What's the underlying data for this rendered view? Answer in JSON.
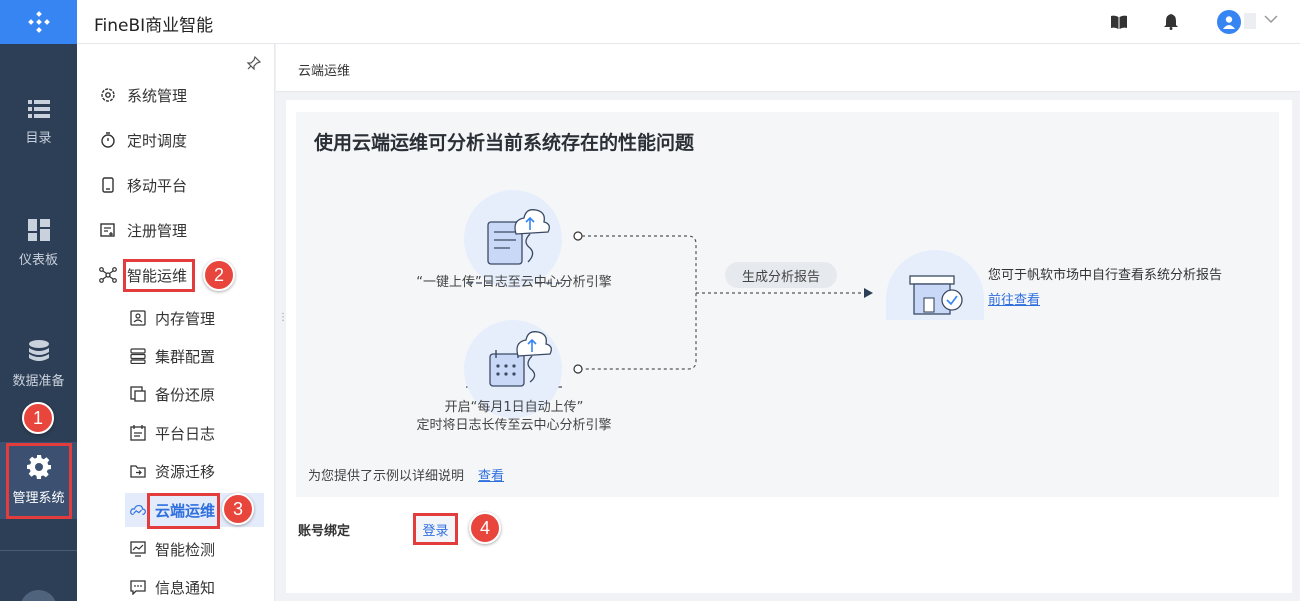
{
  "app": {
    "title": "FineBI商业智能"
  },
  "rail": {
    "items": [
      {
        "label": "目录",
        "icon": "list-icon"
      },
      {
        "label": "仪表板",
        "icon": "dashboard-icon"
      },
      {
        "label": "数据准备",
        "icon": "database-icon"
      },
      {
        "label": "管理系统",
        "icon": "gear-icon"
      }
    ]
  },
  "sidebar": {
    "items": [
      {
        "label": "系统管理",
        "icon": "settings-icon"
      },
      {
        "label": "定时调度",
        "icon": "timer-icon"
      },
      {
        "label": "移动平台",
        "icon": "mobile-icon"
      },
      {
        "label": "注册管理",
        "icon": "register-icon"
      },
      {
        "label": "智能运维",
        "icon": "network-icon"
      }
    ],
    "subitems": [
      {
        "label": "内存管理",
        "icon": "memory-icon"
      },
      {
        "label": "集群配置",
        "icon": "cluster-icon"
      },
      {
        "label": "备份还原",
        "icon": "backup-icon"
      },
      {
        "label": "平台日志",
        "icon": "log-icon"
      },
      {
        "label": "资源迁移",
        "icon": "folder-icon"
      },
      {
        "label": "云端运维",
        "icon": "cloud-ops-icon"
      },
      {
        "label": "智能检测",
        "icon": "detect-icon"
      },
      {
        "label": "信息通知",
        "icon": "message-icon"
      }
    ]
  },
  "breadcrumb": "云端运维",
  "intro": {
    "title": "使用云端运维可分析当前系统存在的性能问题",
    "upload_caption": "“一键上传”日志至云中心分析引擎",
    "auto_caption_line1": "开启“每月1日自动上传”",
    "auto_caption_line2": "定时将日志长传至云中心分析引擎",
    "generate_label": "生成分析报告",
    "result_text": "您可于帆软市场中自行查看系统分析报告",
    "result_link": "前往查看",
    "example_text": "为您提供了示例以详细说明",
    "example_link": "查看"
  },
  "account": {
    "label": "账号绑定",
    "login_label": "登录"
  },
  "annotations": [
    "1",
    "2",
    "3",
    "4"
  ],
  "colors": {
    "accent": "#3685f2",
    "rail": "#2d3f56",
    "annotation": "#e23c3c",
    "link": "#2f6fde"
  }
}
